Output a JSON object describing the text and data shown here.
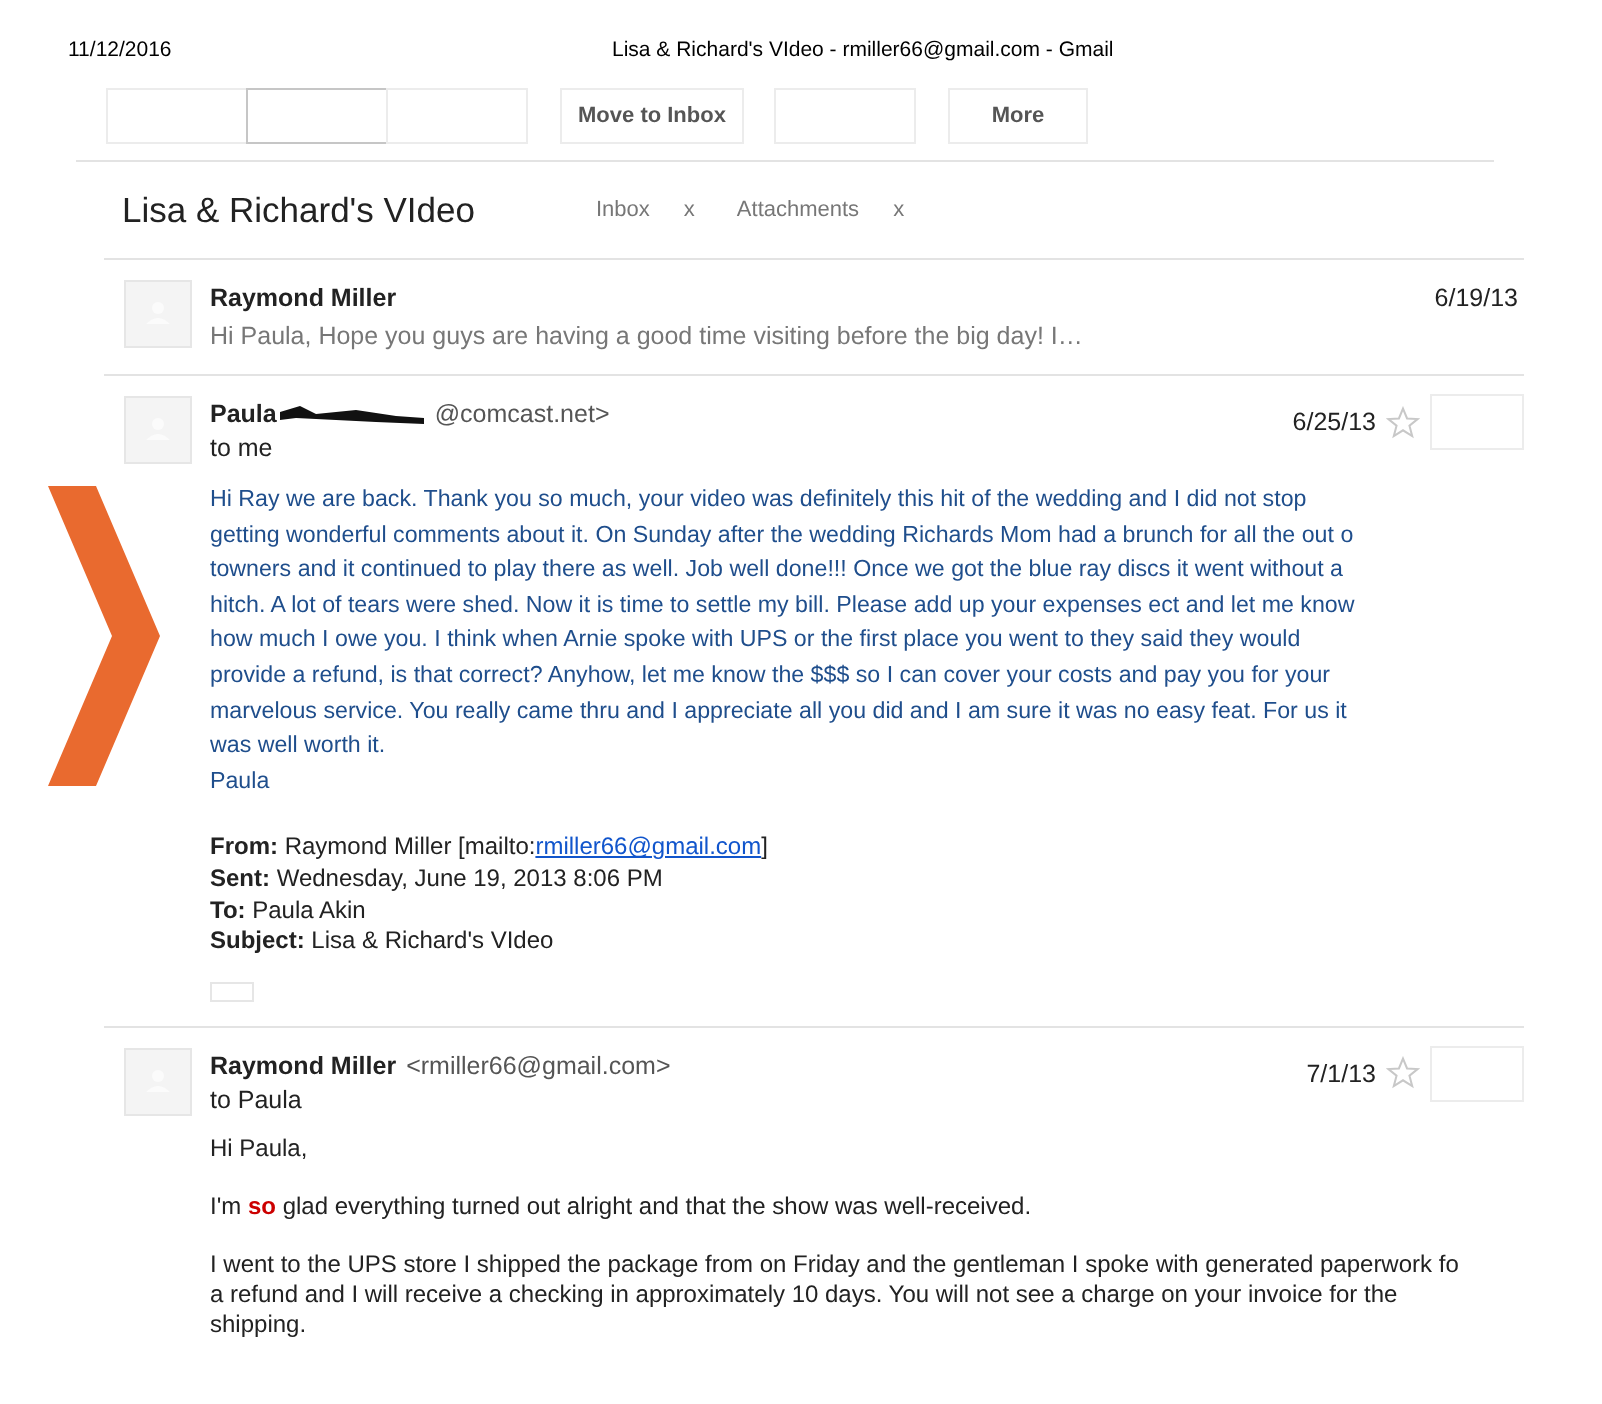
{
  "header": {
    "date": "11/12/2016",
    "title": "Lisa & Richard's VIdeo - rmiller66@gmail.com - Gmail"
  },
  "toolbar": [
    {
      "kind": "blank",
      "selected": false
    },
    {
      "kind": "blank",
      "selected": true
    },
    {
      "kind": "blank",
      "selected": false
    },
    {
      "kind": "text",
      "label": "Move to Inbox",
      "selected": false
    },
    {
      "kind": "blank",
      "selected": false
    },
    {
      "kind": "text",
      "label": "More",
      "selected": false
    }
  ],
  "subject": "Lisa & Richard's VIdeo",
  "labels": [
    {
      "name": "Inbox",
      "remove": "x"
    },
    {
      "name": "Attachments",
      "remove": "x"
    }
  ],
  "messages": [
    {
      "kind": "collapsed",
      "sender": "Raymond Miller",
      "date": "6/19/13",
      "snippet": "Hi Paula, Hope you guys are having a good time visiting before the big day! I…"
    },
    {
      "kind": "expanded",
      "sender": "Paula",
      "address_redacted": true,
      "address": "@comcast.net>",
      "date": "6/25/13",
      "starred": false,
      "recipient": "to me",
      "show_trimmed": true,
      "body": [
        {
          "kind": "letter",
          "lines": [
            "Hi Ray we are back.  Thank you so much, your video was definitely this hit of the wedding and I did not stop",
            "getting wonderful comments about it.  On Sunday after the wedding Richards Mom had a brunch for all the out o",
            "towners and it continued to play there as well.  Job well done!!!  Once we got the blue ray discs it went without a",
            "hitch. A lot of tears were shed.  Now it is time to settle my bill.  Please add up your expenses ect and let me know",
            "how much I owe you.  I think when Arnie spoke with UPS or the first place you went to they said they would",
            "provide a refund, is that correct?  Anyhow, let me know the $$$ so I can cover your costs and pay you for your",
            "marvelous service.  You really came thru and I appreciate all you did and I am sure it was no easy feat.  For us it",
            "was well worth it.",
            "Paula"
          ]
        },
        {
          "kind": "fields",
          "fields": [
            {
              "label": "From:",
              "value": "Raymond Miller [mailto:",
              "link": "rmiller66@gmail.com",
              "after": "]"
            },
            {
              "label": "Sent:",
              "value": "Wednesday, June 19, 2013 8:06 PM"
            },
            {
              "label": "To:",
              "value": "Paula Akin"
            },
            {
              "label": "Subject:",
              "value": "Lisa & Richard's VIdeo"
            }
          ]
        }
      ]
    },
    {
      "kind": "expanded",
      "sender": "Raymond Miller",
      "address_redacted": false,
      "address": "<rmiller66@gmail.com>",
      "date": "7/1/13",
      "starred": false,
      "recipient": "to Paula",
      "show_trimmed": false,
      "body": [
        {
          "kind": "plain",
          "lines": [
            "Hi Paula,"
          ]
        },
        {
          "kind": "plain",
          "lines": [
            "I'm **so** glad everything turned out alright and that the show was well-received."
          ]
        },
        {
          "kind": "plain",
          "lines": [
            "I went to the UPS store I shipped the package from on Friday and the gentleman I spoke with generated paperwork fo",
            "a refund and I will receive a checking in approximately 10 days. You will not see a charge on your invoice for the",
            "shipping."
          ]
        }
      ]
    }
  ]
}
